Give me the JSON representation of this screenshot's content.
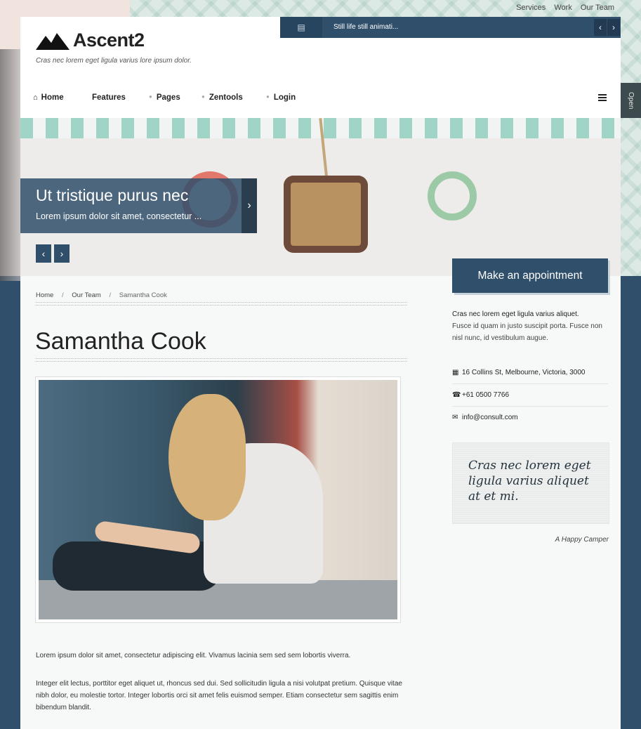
{
  "top_links": [
    "Services",
    "Work",
    "Our Team"
  ],
  "brand": {
    "name": "Ascent2",
    "tagline": "Cras nec lorem eget ligula varius lore ipsum dolor."
  },
  "ticker": {
    "text": "Still life still animati...",
    "icon": "newspaper-icon"
  },
  "nav": {
    "items": [
      {
        "label": "Home",
        "icon": "home-icon"
      },
      {
        "label": "Features"
      },
      {
        "label": "Pages"
      },
      {
        "label": "Zentools"
      },
      {
        "label": "Login"
      }
    ],
    "menu_icon": "hamburger-icon"
  },
  "side_tab": {
    "label": "Open"
  },
  "hero": {
    "caption_title": "Ut tristique purus nec",
    "caption_subtitle": "Lorem ipsum dolor sit amet, consectetur ..."
  },
  "breadcrumb": [
    "Home",
    "Our Team",
    "Samantha Cook"
  ],
  "page": {
    "title": "Samantha Cook",
    "paragraphs": [
      "Lorem ipsum dolor sit amet, consectetur adipiscing elit. Vivamus lacinia sem sed sem lobortis viverra.",
      "Integer elit lectus, porttitor eget aliquet ut, rhoncus sed dui. Sed sollicitudin ligula a nisi volutpat pretium. Quisque vitae nibh dolor, eu molestie tortor. Integer lobortis orci sit amet felis euismod semper. Etiam consectetur sem sagittis enim bibendum blandit."
    ]
  },
  "sidebar": {
    "appointment_label": "Make an appointment",
    "intro_lead": "Cras nec lorem eget ligula varius aliquet.",
    "intro_text": "Fusce id quam in justo suscipit porta. Fusce non nisl nunc, id vestibulum augue.",
    "contacts": [
      {
        "icon": "map-icon",
        "text": "16 Collins St, Melbourne, Victoria, 3000"
      },
      {
        "icon": "phone-icon",
        "text": "+61 0500 7766"
      },
      {
        "icon": "envelope-icon",
        "text": "info@consult.com"
      }
    ],
    "quote": "Cras nec lorem eget ligula varius aliquet at et mi.",
    "quote_author": "A Happy Camper"
  },
  "colors": {
    "primary": "#2f4f6b",
    "dark": "#223b52",
    "tab": "#3d4a4e",
    "content_bg": "#f7f8f8"
  }
}
